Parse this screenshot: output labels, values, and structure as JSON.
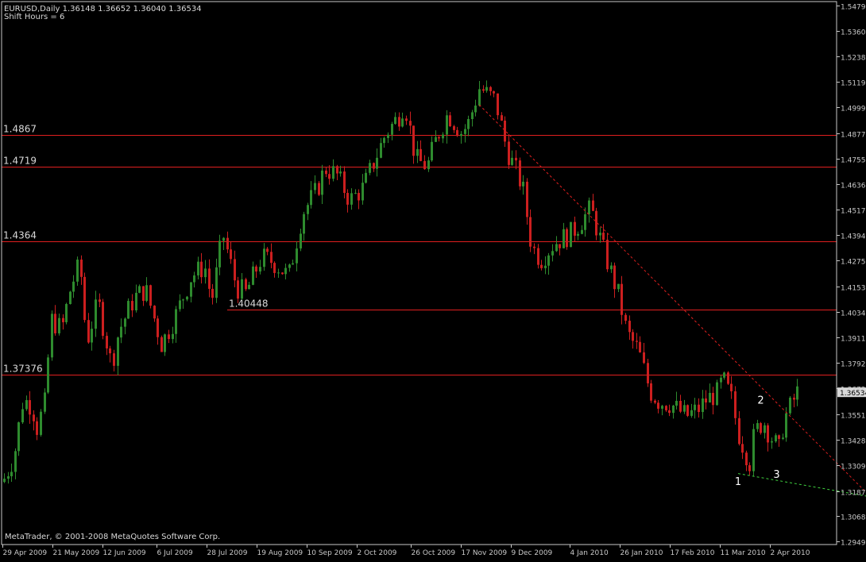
{
  "header": {
    "symbol_line": "EURUSD,Daily  1.36148 1.36652 1.36040 1.36534",
    "shift_line": "Shift Hours = 6"
  },
  "footer": {
    "copyright": "MetaTrader, © 2001-2008 MetaQuotes Software Corp."
  },
  "colors": {
    "background": "#000000",
    "axis": "#c8c8c8",
    "bull_candle": "#2e8b2e",
    "bear_candle": "#cc1f1f",
    "level_line": "#e01f1f",
    "trend_line": "#e01f1f",
    "support_line": "#3fd03f",
    "price_tag_bg": "#d8d8d8"
  },
  "chart_data": {
    "type": "candlestick",
    "symbol": "EURUSD",
    "timeframe": "Daily",
    "ylim": [
      1.2935,
      1.5497
    ],
    "y_ticks": [
      "1.54790",
      "1.53600",
      "1.52380",
      "1.51190",
      "1.49995",
      "1.48770",
      "1.47550",
      "1.46360",
      "1.45170",
      "1.43945",
      "1.42755",
      "1.41530",
      "1.40340",
      "1.39115",
      "1.37925",
      "1.36720",
      "1.35510",
      "1.34285",
      "1.33095",
      "1.31870",
      "1.30680",
      "1.29490"
    ],
    "x_ticks": [
      "29 Apr 2009",
      "21 May 2009",
      "12 Jun 2009",
      "6 Jul 2009",
      "28 Jul 2009",
      "19 Aug 2009",
      "10 Sep 2009",
      "2 Oct 2009",
      "26 Oct 2009",
      "17 Nov 2009",
      "9 Dec 2009",
      "4 Jan 2010",
      "26 Jan 2010",
      "17 Feb 2010",
      "11 Mar 2010",
      "2 Apr 2010"
    ],
    "current_price": "1.36534",
    "horizontal_levels": [
      {
        "value": 1.4867,
        "label": "1.4867",
        "from": "29 Apr 2009"
      },
      {
        "value": 1.4719,
        "label": "1.4719",
        "from": "29 Apr 2009"
      },
      {
        "value": 1.4364,
        "label": "1.4364",
        "from": "29 Apr 2009"
      },
      {
        "value": 1.40448,
        "label": "1.40448",
        "from": "6 Aug 2009"
      },
      {
        "value": 1.37376,
        "label": "1.37376",
        "from": "29 Apr 2009"
      }
    ],
    "trend_lines": [
      {
        "name": "resistance",
        "style": "dashed",
        "from": [
          "25 Nov 2009",
          1.501
        ],
        "to": [
          "28 Apr 2010",
          1.3113
        ]
      },
      {
        "name": "support",
        "style": "dashed",
        "from": [
          "19 Mar 2010",
          1.327
        ],
        "to": [
          "28 Apr 2010",
          1.311
        ]
      }
    ],
    "wave_labels": [
      {
        "label": "1",
        "date": "19 Mar 2010",
        "price": 1.3215
      },
      {
        "label": "2",
        "date": "29 Mar 2010",
        "price": 1.36
      },
      {
        "label": "3",
        "date": "5 Apr 2010",
        "price": 1.325
      }
    ],
    "close_path": [
      [
        "29 Apr 2009",
        1.323
      ],
      [
        "4 May 2009",
        1.335
      ],
      [
        "8 May 2009",
        1.362
      ],
      [
        "12 May 2009",
        1.359
      ],
      [
        "14 May 2009",
        1.348
      ],
      [
        "18 May 2009",
        1.362
      ],
      [
        "20 May 2009",
        1.4
      ],
      [
        "25 May 2009",
        1.395
      ],
      [
        "29 May 2009",
        1.415
      ],
      [
        "2 Jun 2009",
        1.426
      ],
      [
        "5 Jun 2009",
        1.389
      ],
      [
        "10 Jun 2009",
        1.408
      ],
      [
        "16 Jun 2009",
        1.378
      ],
      [
        "19 Jun 2009",
        1.394
      ],
      [
        "26 Jun 2009",
        1.41
      ],
      [
        "1 Jul 2009",
        1.414
      ],
      [
        "8 Jul 2009",
        1.388
      ],
      [
        "14 Jul 2009",
        1.401
      ],
      [
        "21 Jul 2009",
        1.42
      ],
      [
        "27 Jul 2009",
        1.425
      ],
      [
        "30 Jul 2009",
        1.408
      ],
      [
        "4 Aug 2009",
        1.44
      ],
      [
        "10 Aug 2009",
        1.415
      ],
      [
        "14 Aug 2009",
        1.412
      ],
      [
        "21 Aug 2009",
        1.429
      ],
      [
        "26 Aug 2009",
        1.427
      ],
      [
        "2 Sep 2009",
        1.42
      ],
      [
        "8 Sep 2009",
        1.45
      ],
      [
        "14 Sep 2009",
        1.46
      ],
      [
        "18 Sep 2009",
        1.471
      ],
      [
        "23 Sep 2009",
        1.468
      ],
      [
        "29 Sep 2009",
        1.456
      ],
      [
        "5 Oct 2009",
        1.462
      ],
      [
        "9 Oct 2009",
        1.473
      ],
      [
        "15 Oct 2009",
        1.488
      ],
      [
        "20 Oct 2009",
        1.495
      ],
      [
        "23 Oct 2009",
        1.502
      ],
      [
        "28 Oct 2009",
        1.475
      ],
      [
        "2 Nov 2009",
        1.472
      ],
      [
        "6 Nov 2009",
        1.485
      ],
      [
        "11 Nov 2009",
        1.497
      ],
      [
        "17 Nov 2009",
        1.488
      ],
      [
        "20 Nov 2009",
        1.492
      ],
      [
        "25 Nov 2009",
        1.509
      ],
      [
        "2 Dec 2009",
        1.503
      ],
      [
        "7 Dec 2009",
        1.48
      ],
      [
        "14 Dec 2009",
        1.462
      ],
      [
        "18 Dec 2009",
        1.434
      ],
      [
        "22 Dec 2009",
        1.428
      ],
      [
        "28 Dec 2009",
        1.436
      ],
      [
        "4 Jan 2010",
        1.44
      ],
      [
        "8 Jan 2010",
        1.445
      ],
      [
        "13 Jan 2010",
        1.452
      ],
      [
        "19 Jan 2010",
        1.431
      ],
      [
        "25 Jan 2010",
        1.412
      ],
      [
        "29 Jan 2010",
        1.393
      ],
      [
        "3 Feb 2010",
        1.385
      ],
      [
        "8 Feb 2010",
        1.366
      ],
      [
        "12 Feb 2010",
        1.361
      ],
      [
        "17 Feb 2010",
        1.36
      ],
      [
        "24 Feb 2010",
        1.354
      ],
      [
        "1 Mar 2010",
        1.357
      ],
      [
        "5 Mar 2010",
        1.362
      ],
      [
        "10 Mar 2010",
        1.365
      ],
      [
        "12 Mar 2010",
        1.372
      ],
      [
        "16 Mar 2010",
        1.362
      ],
      [
        "19 Mar 2010",
        1.346
      ],
      [
        "24 Mar 2010",
        1.332
      ],
      [
        "26 Mar 2010",
        1.346
      ],
      [
        "30 Mar 2010",
        1.352
      ],
      [
        "2 Apr 2010",
        1.345
      ],
      [
        "6 Apr 2010",
        1.338
      ],
      [
        "8 Apr 2010",
        1.352
      ],
      [
        "12 Apr 2010",
        1.361
      ],
      [
        "14 Apr 2010",
        1.3653
      ]
    ]
  }
}
